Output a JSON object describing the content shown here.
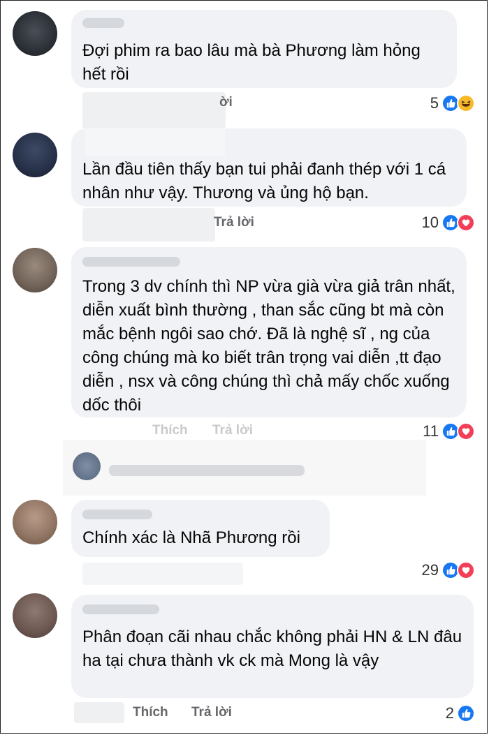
{
  "comments": [
    {
      "text": "Đợi phim ra bao lâu mà bà Phương làm hỏng hết rồi",
      "actions": {
        "like": "",
        "reply": "ời",
        "time": ""
      },
      "reaction_count": "5",
      "reactions": [
        "like-icon",
        "haha-icon"
      ]
    },
    {
      "text": "Lần đầu tiên thấy bạn tui phải đanh thép với 1 cá nhân như vậy. Thương và ủng hộ bạn.",
      "actions": {
        "like": "",
        "reply": "Trả lời",
        "time": ""
      },
      "reaction_count": "10",
      "reactions": [
        "like-icon",
        "love-icon"
      ]
    },
    {
      "text": "Trong 3 dv chính thì NP vừa già vừa giả trân nhất, diễn xuất bình thường , than sắc cũng bt mà còn mắc bệnh ngôi sao chớ. Đã là nghệ sĩ , ng của công chúng mà ko biết trân trọng vai diễn ,tt đạo diễn , nsx và công chúng thì chả mấy chốc xuống dốc thôi",
      "actions": {
        "like": "Thích",
        "reply": "Trả lời",
        "time": ""
      },
      "reaction_count": "11",
      "reactions": [
        "like-icon",
        "love-icon"
      ]
    },
    {
      "text": "Chính xác là Nhã Phương rồi",
      "actions": {
        "like": "",
        "reply": "",
        "time": ""
      },
      "reaction_count": "29",
      "reactions": [
        "like-icon",
        "love-icon"
      ]
    },
    {
      "text": "Phân đoạn cãi nhau chắc không phải HN & LN đâu ha tại chưa thành vk ck mà Mong là vậy",
      "actions": {
        "like": "Thích",
        "reply": "Trả lời",
        "time": ""
      },
      "reaction_count": "2",
      "reactions": [
        "like-icon"
      ]
    }
  ],
  "colors": {
    "bubble": "#f0f2f5",
    "text": "#050505",
    "meta": "#65676b",
    "like": "#1877f2",
    "love": "#f33e58",
    "haha": "#f7b928"
  }
}
